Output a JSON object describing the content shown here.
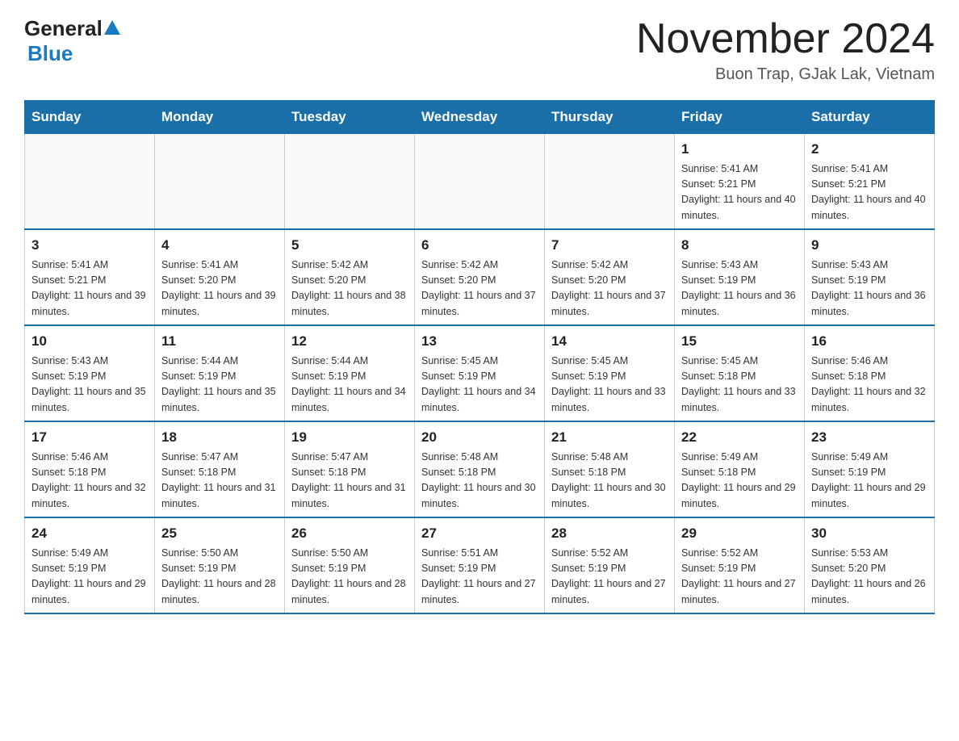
{
  "header": {
    "logo_general": "General",
    "logo_blue": "Blue",
    "month_title": "November 2024",
    "subtitle": "Buon Trap, GJak Lak, Vietnam"
  },
  "days_of_week": [
    "Sunday",
    "Monday",
    "Tuesday",
    "Wednesday",
    "Thursday",
    "Friday",
    "Saturday"
  ],
  "weeks": [
    [
      {
        "day": "",
        "info": ""
      },
      {
        "day": "",
        "info": ""
      },
      {
        "day": "",
        "info": ""
      },
      {
        "day": "",
        "info": ""
      },
      {
        "day": "",
        "info": ""
      },
      {
        "day": "1",
        "info": "Sunrise: 5:41 AM\nSunset: 5:21 PM\nDaylight: 11 hours and 40 minutes."
      },
      {
        "day": "2",
        "info": "Sunrise: 5:41 AM\nSunset: 5:21 PM\nDaylight: 11 hours and 40 minutes."
      }
    ],
    [
      {
        "day": "3",
        "info": "Sunrise: 5:41 AM\nSunset: 5:21 PM\nDaylight: 11 hours and 39 minutes."
      },
      {
        "day": "4",
        "info": "Sunrise: 5:41 AM\nSunset: 5:20 PM\nDaylight: 11 hours and 39 minutes."
      },
      {
        "day": "5",
        "info": "Sunrise: 5:42 AM\nSunset: 5:20 PM\nDaylight: 11 hours and 38 minutes."
      },
      {
        "day": "6",
        "info": "Sunrise: 5:42 AM\nSunset: 5:20 PM\nDaylight: 11 hours and 37 minutes."
      },
      {
        "day": "7",
        "info": "Sunrise: 5:42 AM\nSunset: 5:20 PM\nDaylight: 11 hours and 37 minutes."
      },
      {
        "day": "8",
        "info": "Sunrise: 5:43 AM\nSunset: 5:19 PM\nDaylight: 11 hours and 36 minutes."
      },
      {
        "day": "9",
        "info": "Sunrise: 5:43 AM\nSunset: 5:19 PM\nDaylight: 11 hours and 36 minutes."
      }
    ],
    [
      {
        "day": "10",
        "info": "Sunrise: 5:43 AM\nSunset: 5:19 PM\nDaylight: 11 hours and 35 minutes."
      },
      {
        "day": "11",
        "info": "Sunrise: 5:44 AM\nSunset: 5:19 PM\nDaylight: 11 hours and 35 minutes."
      },
      {
        "day": "12",
        "info": "Sunrise: 5:44 AM\nSunset: 5:19 PM\nDaylight: 11 hours and 34 minutes."
      },
      {
        "day": "13",
        "info": "Sunrise: 5:45 AM\nSunset: 5:19 PM\nDaylight: 11 hours and 34 minutes."
      },
      {
        "day": "14",
        "info": "Sunrise: 5:45 AM\nSunset: 5:19 PM\nDaylight: 11 hours and 33 minutes."
      },
      {
        "day": "15",
        "info": "Sunrise: 5:45 AM\nSunset: 5:18 PM\nDaylight: 11 hours and 33 minutes."
      },
      {
        "day": "16",
        "info": "Sunrise: 5:46 AM\nSunset: 5:18 PM\nDaylight: 11 hours and 32 minutes."
      }
    ],
    [
      {
        "day": "17",
        "info": "Sunrise: 5:46 AM\nSunset: 5:18 PM\nDaylight: 11 hours and 32 minutes."
      },
      {
        "day": "18",
        "info": "Sunrise: 5:47 AM\nSunset: 5:18 PM\nDaylight: 11 hours and 31 minutes."
      },
      {
        "day": "19",
        "info": "Sunrise: 5:47 AM\nSunset: 5:18 PM\nDaylight: 11 hours and 31 minutes."
      },
      {
        "day": "20",
        "info": "Sunrise: 5:48 AM\nSunset: 5:18 PM\nDaylight: 11 hours and 30 minutes."
      },
      {
        "day": "21",
        "info": "Sunrise: 5:48 AM\nSunset: 5:18 PM\nDaylight: 11 hours and 30 minutes."
      },
      {
        "day": "22",
        "info": "Sunrise: 5:49 AM\nSunset: 5:18 PM\nDaylight: 11 hours and 29 minutes."
      },
      {
        "day": "23",
        "info": "Sunrise: 5:49 AM\nSunset: 5:19 PM\nDaylight: 11 hours and 29 minutes."
      }
    ],
    [
      {
        "day": "24",
        "info": "Sunrise: 5:49 AM\nSunset: 5:19 PM\nDaylight: 11 hours and 29 minutes."
      },
      {
        "day": "25",
        "info": "Sunrise: 5:50 AM\nSunset: 5:19 PM\nDaylight: 11 hours and 28 minutes."
      },
      {
        "day": "26",
        "info": "Sunrise: 5:50 AM\nSunset: 5:19 PM\nDaylight: 11 hours and 28 minutes."
      },
      {
        "day": "27",
        "info": "Sunrise: 5:51 AM\nSunset: 5:19 PM\nDaylight: 11 hours and 27 minutes."
      },
      {
        "day": "28",
        "info": "Sunrise: 5:52 AM\nSunset: 5:19 PM\nDaylight: 11 hours and 27 minutes."
      },
      {
        "day": "29",
        "info": "Sunrise: 5:52 AM\nSunset: 5:19 PM\nDaylight: 11 hours and 27 minutes."
      },
      {
        "day": "30",
        "info": "Sunrise: 5:53 AM\nSunset: 5:20 PM\nDaylight: 11 hours and 26 minutes."
      }
    ]
  ]
}
